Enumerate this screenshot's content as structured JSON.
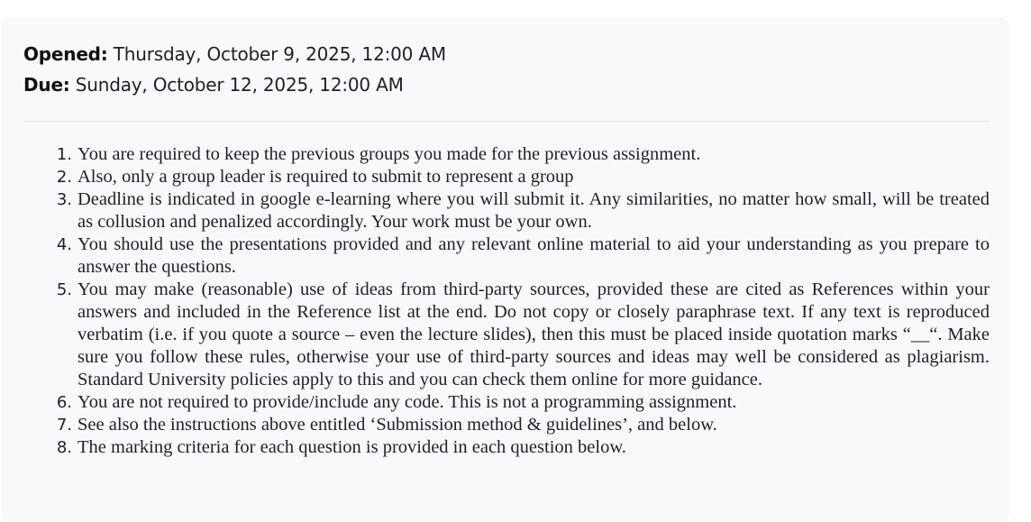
{
  "dates": {
    "opened_label": "Opened:",
    "opened_value": "Thursday, October 9, 2025, 12:00 AM",
    "due_label": "Due:",
    "due_value": "Sunday, October 12, 2025, 12:00 AM"
  },
  "instructions": [
    {
      "number": "1.",
      "text": "You are required to keep the previous groups you made for the previous assignment."
    },
    {
      "number": "2.",
      "text": "Also, only a group leader is required to submit to represent a group"
    },
    {
      "number": "3.",
      "text": "Deadline is indicated in google e-learning where you will submit it.  Any similarities, no matter how small, will be treated as collusion and penalized accordingly. Your work must be your own."
    },
    {
      "number": "4.",
      "text": "You should use the presentations provided and any relevant online material to aid your understanding as you prepare to answer the questions."
    },
    {
      "number": "5.",
      "text": "You may make (reasonable) use of ideas from third-party sources, provided these are cited as  References within your answers and included in the Reference list at the end. Do not copy or closely  paraphrase text. If any text is reproduced verbatim (i.e. if you quote a source – even the lecture slides),  then this must be placed inside quotation marks “__“. Make sure you follow these rules, otherwise your use of third-party sources and ideas may well be considered as plagiarism. Standard University policies apply to this and you can check them online for more guidance."
    },
    {
      "number": "6.",
      "text": "You are not required to provide/include any code. This is not a programming assignment."
    },
    {
      "number": "7.",
      "text": "See also the instructions above entitled ‘Submission method & guidelines’, and below."
    },
    {
      "number": "8.",
      "text": "The marking criteria for each question is provided in each question below."
    }
  ]
}
